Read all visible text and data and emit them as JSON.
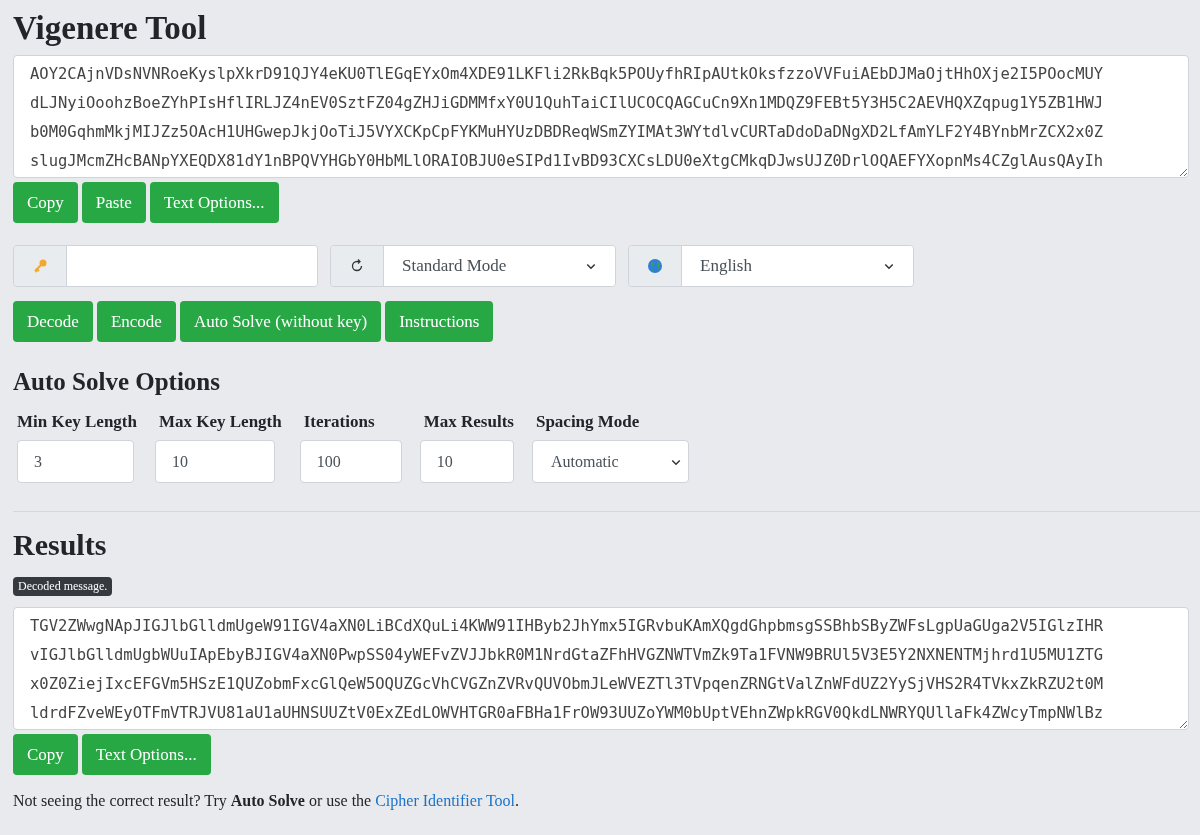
{
  "title": "Vigenere Tool",
  "input_text": [
    "AOY2CAjnVDsNVNRoeKyslpXkrD91QJY4eKU0TlEGqEYxOm4XDE91LKFli2RkBqk5POUyfhRIpAUtkOksfzzoVVFuiAEbDJMaOjtHhOXje2I5POocMUY",
    "dLJNyiOoohzBoeZYhPIsHflIRLJZ4nEV0SztFZ04gZHJiGDMMfxY0U1QuhTaiCIlUCOCQAGCuCn9Xn1MDQZ9FEBt5Y3H5C2AEVHQXZqpug1Y5ZB1HWJ",
    "b0M0GqhmMkjMIJZz5OAcH1UHGwepJkjOoTiJ5VYXCKpCpFYKMuHYUzDBDReqWSmZYIMAt3WYtdlvCURTaDdoDaDNgXD2LfAmYLF2Y4BYnbMrZCX2x0Z",
    "slugJMcmZHcBANpYXEQDX81dY1nBPQVYHGbY0HbMLlORAIOBJU0eSIPd1IvBD93CXCsLDU0eXtgCMkqDJwsUJZ0DrlOQAEFYXopnMs4CZglAusQAyIh"
  ],
  "input_buttons": [
    "Copy",
    "Paste",
    "Text Options..."
  ],
  "settings": [
    {
      "kind": "key"
    },
    {
      "kind": "mode",
      "value": "Standard Mode"
    },
    {
      "kind": "language",
      "value": "English"
    }
  ],
  "action_buttons": [
    "Decode",
    "Encode",
    "Auto Solve (without key)",
    "Instructions"
  ],
  "auto_solve": {
    "heading": "Auto Solve Options",
    "fields": [
      {
        "kind": "input",
        "label": "Min Key Length",
        "value": "3"
      },
      {
        "kind": "input",
        "label": "Max Key Length",
        "value": "10"
      },
      {
        "kind": "input",
        "label": "Iterations",
        "value": "100"
      },
      {
        "kind": "input",
        "label": "Max Results",
        "value": "10"
      },
      {
        "kind": "select",
        "label": "Spacing Mode",
        "value": "Automatic"
      }
    ]
  },
  "results": {
    "heading": "Results",
    "badge": "Decoded message.",
    "text": [
      "TGV2ZWwgNApJIGJlbGlldmUgeW91IGV4aXN0LiBCdXQuLi4KWW91IHByb2JhYmx5IGRvbuKAmXQgdGhpbmsgSSBhbSByZWFsLgpUaGUga2V5IGlzIHR",
      "vIGJlbGlldmUgbWUuIApEbyBJIGV4aXN0PwpSS04yWEFvZVJJbkR0M1NrdGtaZFhHVGZNWTVmZk9Ta1FVNW9BRUl5V3E5Y2NXNENTMjhrd1U5MU1ZTG",
      "x0Z0ZiejIxcEFGVm5HSzE1QUZobmFxcGlQeW5OQUZGcVhCVGZnZVRvQUVObmJLeWVEZTl3TVpqenZRNGtValZnWFdUZ2YySjVHS2R4TVkxZkRZU2t0M",
      "ldrdFZveWEyOTFmVTRJVU81aU1aUHNSUUZtV0ExZEdLOWVHTGR0aFBHa1FrOW93UUZoYWM0bUptVEhnZWpkRGV0QkdLNWRYQUllaFk4ZWcyTmpNWlBz"
    ],
    "buttons": [
      "Copy",
      "Text Options..."
    ]
  },
  "footer": {
    "text": "Not seeing the correct result? Try **Auto Solve** or use the",
    "link": "Cipher Identifier Tool",
    "after": "."
  }
}
